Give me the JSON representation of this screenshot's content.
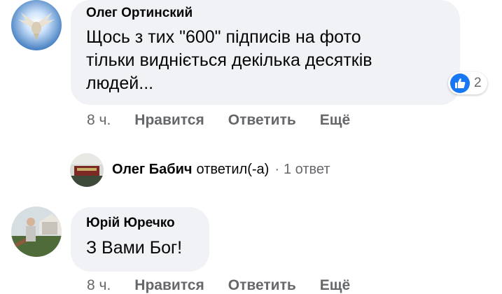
{
  "comments": [
    {
      "author": "Олег Ортинский",
      "text_lines": [
        "Щось з тих \"600\" підписів на фото",
        "тільки видніється декілька десятків",
        "людей..."
      ],
      "reactions": {
        "icon": "like-icon",
        "count": "2"
      },
      "actions": {
        "time": "8 ч.",
        "like": "Нравится",
        "reply": "Ответить",
        "more": "Ещё"
      }
    },
    {
      "author": "Юрій Юречко",
      "text_lines": [
        "З Вами Бог!"
      ],
      "actions": {
        "time": "8 ч.",
        "like": "Нравится",
        "reply": "Ответить",
        "more": "Ещё"
      }
    }
  ],
  "reply_summary": {
    "name": "Олег Бабич",
    "verb": "ответил(-а)",
    "separator": "·",
    "count": "1 ответ"
  },
  "colors": {
    "bubble": "#f0f2f5",
    "secondary_text": "#65676b",
    "like_blue": "#1877f2"
  }
}
